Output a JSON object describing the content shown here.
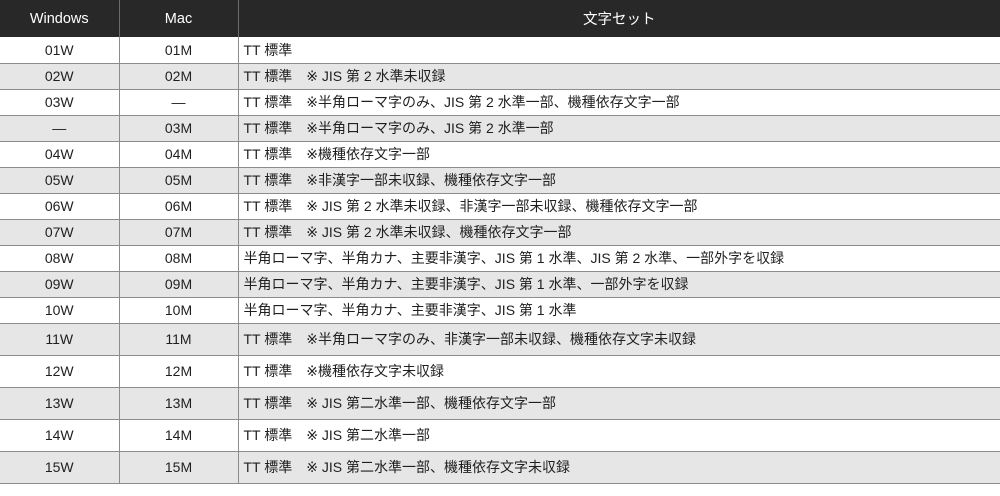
{
  "header": {
    "windows": "Windows",
    "mac": "Mac",
    "charset": "文字セット"
  },
  "rows": [
    {
      "win": "01W",
      "mac": "01M",
      "desc": "TT 標準"
    },
    {
      "win": "02W",
      "mac": "02M",
      "desc": "TT 標準　※ JIS 第 2 水準未収録"
    },
    {
      "win": "03W",
      "mac": "—",
      "desc": "TT 標準　※半角ローマ字のみ、JIS 第 2 水準一部、機種依存文字一部"
    },
    {
      "win": "—",
      "mac": "03M",
      "desc": "TT 標準　※半角ローマ字のみ、JIS 第 2 水準一部"
    },
    {
      "win": "04W",
      "mac": "04M",
      "desc": "TT 標準　※機種依存文字一部"
    },
    {
      "win": "05W",
      "mac": "05M",
      "desc": "TT 標準　※非漢字一部未収録、機種依存文字一部"
    },
    {
      "win": "06W",
      "mac": "06M",
      "desc": "TT 標準　※ JIS 第 2 水準未収録、非漢字一部未収録、機種依存文字一部"
    },
    {
      "win": "07W",
      "mac": "07M",
      "desc": "TT 標準　※ JIS 第 2 水準未収録、機種依存文字一部"
    },
    {
      "win": "08W",
      "mac": "08M",
      "desc": "半角ローマ字、半角カナ、主要非漢字、JIS 第 1 水準、JIS 第 2 水準、一部外字を収録"
    },
    {
      "win": "09W",
      "mac": "09M",
      "desc": "半角ローマ字、半角カナ、主要非漢字、JIS 第 1 水準、一部外字を収録"
    },
    {
      "win": "10W",
      "mac": "10M",
      "desc": "半角ローマ字、半角カナ、主要非漢字、JIS 第 1 水準"
    },
    {
      "win": "11W",
      "mac": "11M",
      "desc": "TT 標準　※半角ローマ字のみ、非漢字一部未収録、機種依存文字未収録"
    },
    {
      "win": "12W",
      "mac": "12M",
      "desc": "TT 標準　※機種依存文字未収録"
    },
    {
      "win": "13W",
      "mac": "13M",
      "desc": "TT 標準　※ JIS 第二水準一部、機種依存文字一部"
    },
    {
      "win": "14W",
      "mac": "14M",
      "desc": "TT 標準　※ JIS 第二水準一部"
    },
    {
      "win": "15W",
      "mac": "15M",
      "desc": "TT 標準　※ JIS 第二水準一部、機種依存文字未収録"
    }
  ]
}
